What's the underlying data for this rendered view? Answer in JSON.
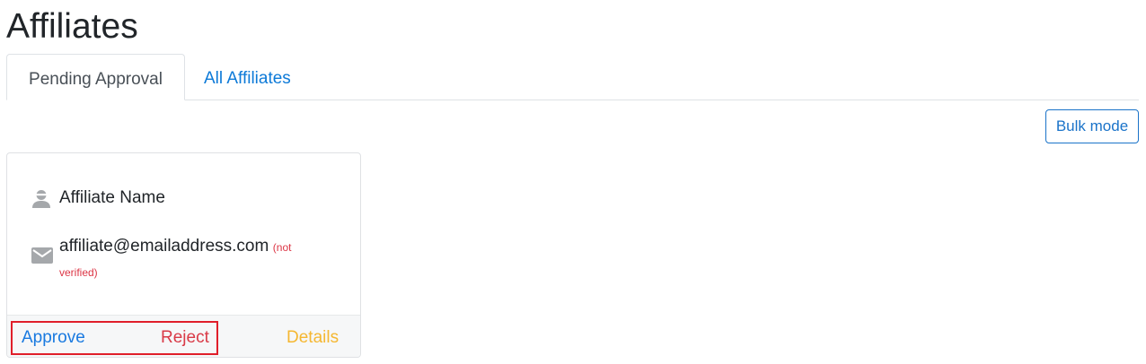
{
  "page": {
    "title": "Affiliates"
  },
  "tabs": [
    {
      "label": "Pending Approval",
      "active": true
    },
    {
      "label": "All Affiliates",
      "active": false
    }
  ],
  "toolbar": {
    "bulk_mode_label": "Bulk mode"
  },
  "affiliate_card": {
    "name": "Affiliate Name",
    "name_icon": "person-icon",
    "email": "affiliate@emailaddress.com",
    "email_icon": "mail-icon",
    "email_status": "(not verified)",
    "actions": {
      "approve_label": "Approve",
      "reject_label": "Reject",
      "details_label": "Details"
    }
  },
  "colors": {
    "link_blue": "#1a7ae0",
    "danger_red": "#d93a47",
    "warning_yellow": "#f5b731",
    "highlight_red": "#e01e2a"
  }
}
